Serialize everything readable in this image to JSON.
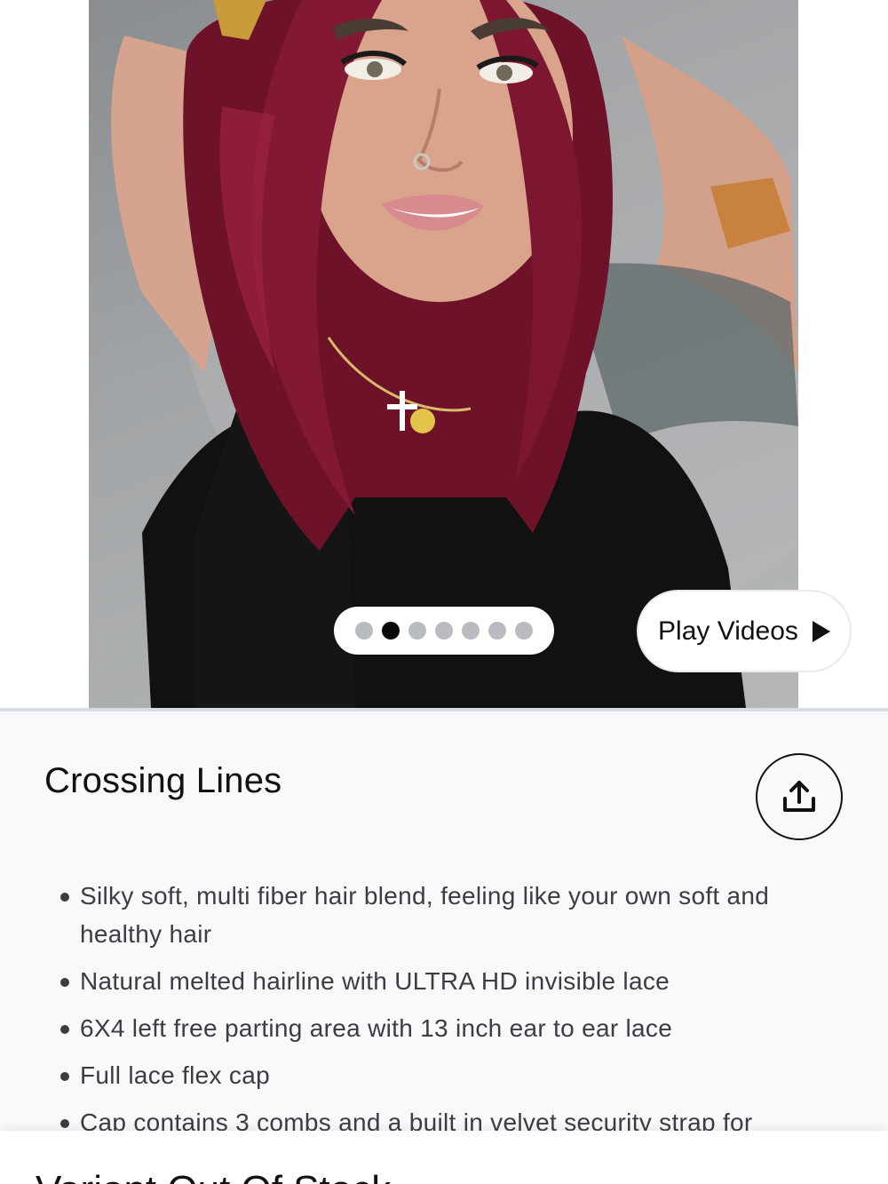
{
  "gallery": {
    "image_alt": "Model wearing burgundy wig",
    "slide_count": 7,
    "active_slide": 2,
    "play_videos_label": "Play Videos"
  },
  "product": {
    "title": "Crossing Lines",
    "features": [
      "Silky soft, multi fiber hair blend, feeling like your own soft and healthy hair",
      "Natural melted hairline with ULTRA HD invisible lace",
      "6X4 left free parting area with 13 inch ear to ear lace",
      "Full lace flex cap",
      "Cap contains 3 combs and a built in velvet security strap for"
    ]
  },
  "stock_notice": {
    "title": "Variant Out Of Stock"
  },
  "colors": {
    "hair": "#7a1530",
    "accent": "#0a0a0a",
    "dot_inactive": "#b8bcc1"
  }
}
